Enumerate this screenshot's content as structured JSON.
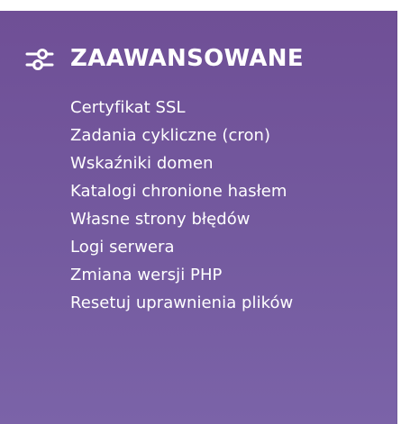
{
  "section": {
    "icon": "sliders-icon",
    "title": "ZAAWANSOWANE"
  },
  "menu_items": [
    "Certyfikat SSL",
    "Zadania cykliczne (cron)",
    "Wskaźniki domen",
    "Katalogi chronione hasłem",
    "Własne strony błędów",
    "Logi serwera",
    "Zmiana wersji PHP",
    "Resetuj uprawnienia plików"
  ],
  "colors": {
    "panel_background": "#735a9f",
    "text": "#ffffff"
  }
}
